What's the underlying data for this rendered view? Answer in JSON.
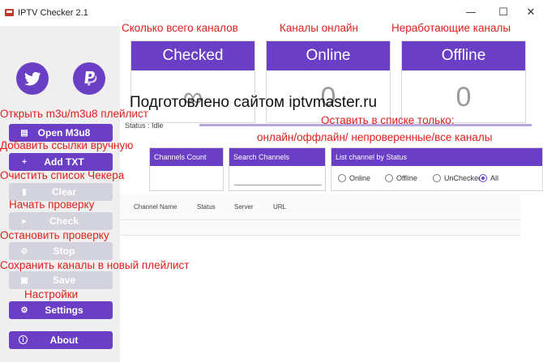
{
  "window": {
    "title": "IPTV Checker 2.1",
    "minimize_glyph": "—",
    "maximize_glyph": "☐",
    "close_glyph": "✕"
  },
  "sidebar": {
    "social": [
      {
        "name": "twitter",
        "icon": "twitter-bird-icon"
      },
      {
        "name": "paypal",
        "icon": "paypal-p-icon"
      }
    ],
    "buttons": [
      {
        "label": "Open M3u8",
        "icon": "file-icon",
        "glyph": "▤",
        "enabled": true
      },
      {
        "label": "Add TXT",
        "icon": "plus-icon",
        "glyph": "+",
        "enabled": true
      },
      {
        "label": "Clear",
        "icon": "trash-icon",
        "glyph": "▮",
        "enabled": false
      },
      {
        "label": "Check",
        "icon": "play-icon",
        "glyph": "▸",
        "enabled": false
      },
      {
        "label": "Stop",
        "icon": "stop-icon",
        "glyph": "⊘",
        "enabled": false
      },
      {
        "label": "Save",
        "icon": "save-icon",
        "glyph": "▣",
        "enabled": false
      },
      {
        "label": "Settings",
        "icon": "gear-icon",
        "glyph": "⚙",
        "enabled": true
      },
      {
        "label": "About",
        "icon": "info-icon",
        "glyph": "i",
        "enabled": true
      }
    ]
  },
  "stats": {
    "checked": {
      "label": "Checked",
      "value": "∞"
    },
    "online": {
      "label": "Online",
      "value": "0"
    },
    "offline": {
      "label": "Offline",
      "value": "0"
    }
  },
  "status": {
    "text": "Status : Idle",
    "progress": 1.0
  },
  "panels": {
    "channels_count": {
      "title": "Channels Count",
      "value": ""
    },
    "search": {
      "title": "Search Channels",
      "value": ""
    },
    "filter": {
      "title": "List channel by Status",
      "options": [
        "Online",
        "Offline",
        "UnChecked",
        "All"
      ],
      "selected": "All"
    }
  },
  "table": {
    "columns": [
      "Channel Name",
      "Status",
      "Server",
      "URL"
    ]
  },
  "annotations": {
    "total_channels": "Сколько всего каналов",
    "online_channels": "Каналы онлайн",
    "offline_channels": "Неработающие каналы",
    "watermark": "Подготовлено сайтом iptvmaster.ru",
    "open_playlist": "Открыть m3u/m3u8 плейлист",
    "filter_line1": "Оставить в списке только:",
    "filter_line2": "онлайн/оффлайн/ непроверенные/все каналы",
    "add_links": "Добавить ссылки вручную",
    "clear_list": "Очистить список Чекера",
    "start_check": "Начать проверку",
    "stop_check": "Остановить проверку",
    "save_channels": "Сохранить каналы в новый плейлист",
    "settings": "Настройки"
  },
  "colors": {
    "accent": "#6a3fc6",
    "disabled": "#d3d3de",
    "annotation": "#e0201c"
  }
}
